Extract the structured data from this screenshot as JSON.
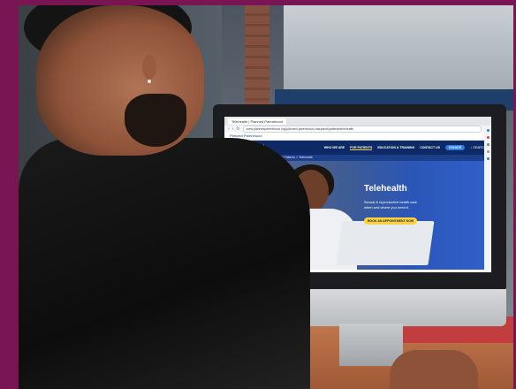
{
  "browser": {
    "tab_label": "Telehealth | Planned Parenthood",
    "url": "www.plannedparenthood.org/planned-parenthood-maryland/patients/telehealth"
  },
  "site": {
    "brand_strip": "Planned Parenthood",
    "logo_text": "Planned Parenthood of Maryland",
    "nav": [
      {
        "label": "WHO WE ARE"
      },
      {
        "label": "FOR PATIENTS"
      },
      {
        "label": "EDUCATION & TRAINING"
      },
      {
        "label": "CONTACT US"
      }
    ],
    "donate_label": "DONATE",
    "search_label": "SEARCH",
    "breadcrumb": "Planned Parenthood of Maryland > For Patients > Telehealth"
  },
  "hero": {
    "title": "Telehealth",
    "subtitle": "Sexual & reproductive health care when and where you need it.",
    "cta_label": "BOOK AN APPOINTMENT NOW"
  },
  "colors": {
    "frame": "#7a1553",
    "nav_bg": "#0e2a66",
    "cta": "#ffd23b",
    "donate": "#2c7be5"
  },
  "sidebar_icons": [
    "mail-icon",
    "bookmark-icon",
    "plus-icon",
    "settings-icon",
    "shield-icon"
  ]
}
